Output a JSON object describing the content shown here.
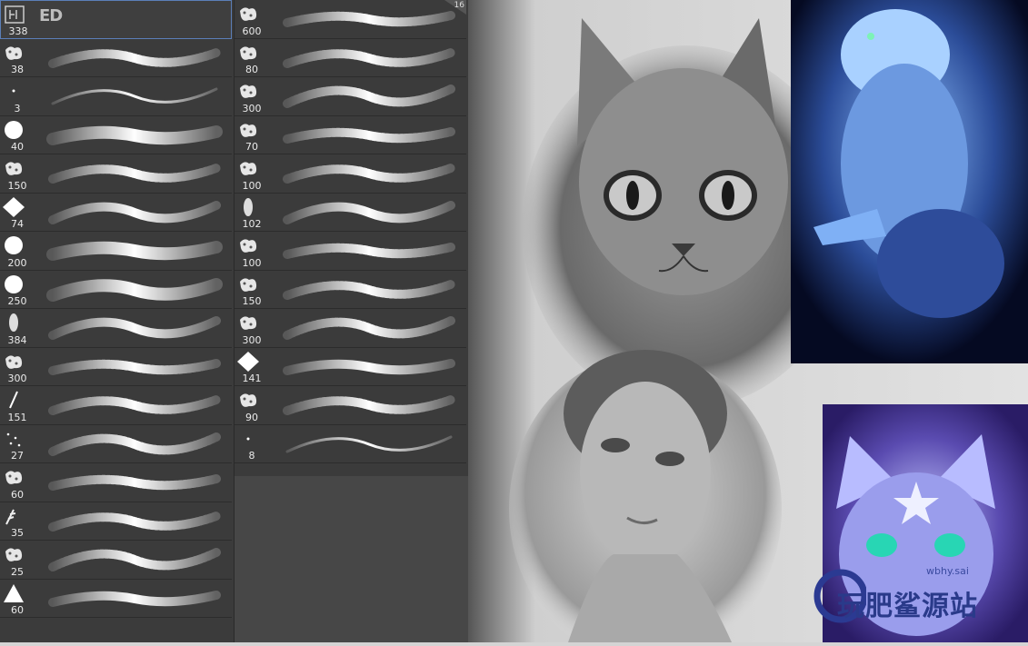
{
  "brush_panel": {
    "selected_preview_label": "ED",
    "corner_label": "16",
    "left_column": [
      {
        "size": "338",
        "shape": "selected"
      },
      {
        "size": "38",
        "shape": "scatter"
      },
      {
        "size": "3",
        "shape": "dot"
      },
      {
        "size": "40",
        "shape": "circle"
      },
      {
        "size": "150",
        "shape": "splatter"
      },
      {
        "size": "74",
        "shape": "diamond"
      },
      {
        "size": "200",
        "shape": "circle"
      },
      {
        "size": "250",
        "shape": "circle"
      },
      {
        "size": "384",
        "shape": "oval"
      },
      {
        "size": "300",
        "shape": "blob"
      },
      {
        "size": "151",
        "shape": "slash"
      },
      {
        "size": "27",
        "shape": "dots"
      },
      {
        "size": "60",
        "shape": "splatter"
      },
      {
        "size": "35",
        "shape": "leaf"
      },
      {
        "size": "25",
        "shape": "splatter"
      },
      {
        "size": "60",
        "shape": "triangle"
      }
    ],
    "right_column": [
      {
        "size": "600",
        "shape": "blob"
      },
      {
        "size": "80",
        "shape": "crackle"
      },
      {
        "size": "300",
        "shape": "splatter"
      },
      {
        "size": "70",
        "shape": "splatter"
      },
      {
        "size": "100",
        "shape": "splatter"
      },
      {
        "size": "102",
        "shape": "oval"
      },
      {
        "size": "100",
        "shape": "hatch"
      },
      {
        "size": "150",
        "shape": "grass"
      },
      {
        "size": "300",
        "shape": "texture"
      },
      {
        "size": "141",
        "shape": "diamond"
      },
      {
        "size": "90",
        "shape": "splatter"
      },
      {
        "size": "8",
        "shape": "dot"
      }
    ]
  },
  "watermark": {
    "text": "玩肥鲨源站",
    "sub": "wbhy.sai"
  }
}
